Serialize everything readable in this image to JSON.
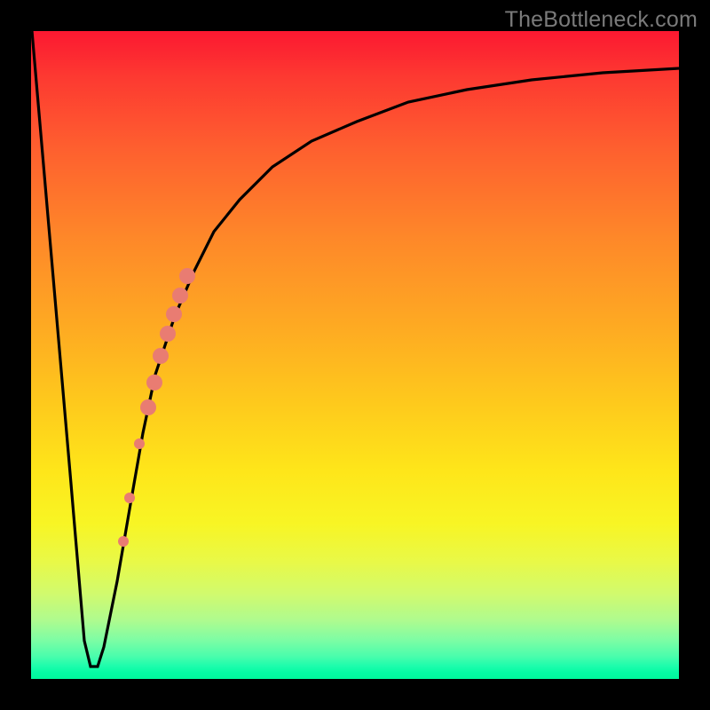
{
  "watermark": "TheBottleneck.com",
  "chart_data": {
    "type": "line",
    "title": "",
    "xlabel": "",
    "ylabel": "",
    "xlim": [
      0,
      100
    ],
    "ylim": [
      0,
      100
    ],
    "background_gradient": {
      "direction": "top-to-bottom",
      "stops": [
        {
          "pos": 0,
          "color": "#fc1831"
        },
        {
          "pos": 50,
          "color": "#fecb1c"
        },
        {
          "pos": 85,
          "color": "#e8f948"
        },
        {
          "pos": 100,
          "color": "#00f89c"
        }
      ]
    },
    "series": [
      {
        "name": "bottleneck-curve",
        "color": "#000000",
        "x": [
          0,
          3,
          6,
          8,
          9,
          10,
          11,
          13,
          15,
          17,
          19,
          22,
          25,
          28,
          32,
          37,
          43,
          50,
          58,
          67,
          77,
          88,
          100
        ],
        "y": [
          100,
          65,
          30,
          6,
          2,
          2,
          5,
          15,
          27,
          38,
          47,
          56,
          63,
          69,
          74,
          79,
          83,
          86,
          89,
          91,
          92.5,
          93.5,
          94.3
        ]
      }
    ],
    "flat_bottom": {
      "x_start": 8,
      "x_end": 10,
      "y": 2
    },
    "highlight_segment": {
      "name": "highlighted-range",
      "color": "#e97c72",
      "points": [
        {
          "x": 14.0,
          "y": 21,
          "r": 6
        },
        {
          "x": 15.0,
          "y": 28,
          "r": 6
        },
        {
          "x": 16.5,
          "y": 36,
          "r": 6
        },
        {
          "x": 18.0,
          "y": 42,
          "r": 9
        },
        {
          "x": 19.0,
          "y": 46,
          "r": 9
        },
        {
          "x": 20.0,
          "y": 50,
          "r": 9
        },
        {
          "x": 21.0,
          "y": 53,
          "r": 9
        },
        {
          "x": 22.0,
          "y": 56,
          "r": 9
        },
        {
          "x": 23.0,
          "y": 59,
          "r": 9
        },
        {
          "x": 24.0,
          "y": 62,
          "r": 9
        }
      ]
    }
  }
}
